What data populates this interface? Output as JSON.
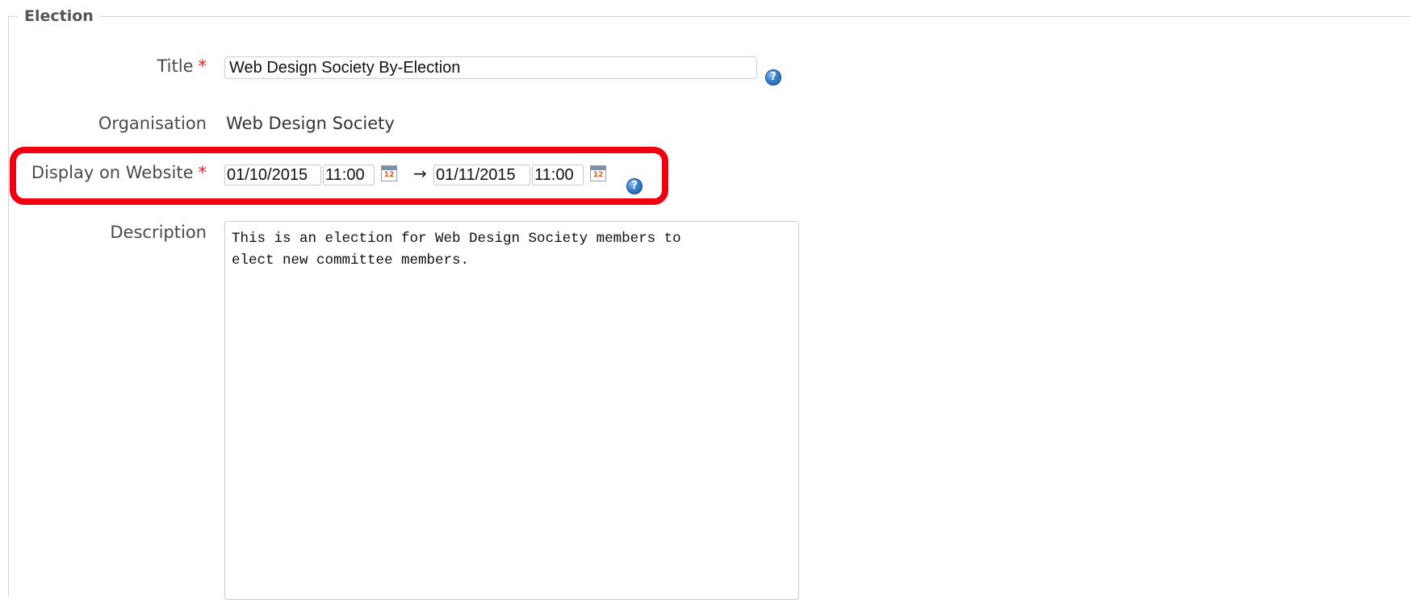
{
  "fieldset": {
    "legend": "Election"
  },
  "fields": {
    "title": {
      "label": "Title",
      "required_marker": "*",
      "value": "Web Design Society By-Election",
      "help_icon": "help-icon"
    },
    "organisation": {
      "label": "Organisation",
      "value": "Web Design Society"
    },
    "display_on_website": {
      "label": "Display on Website",
      "required_marker": "*",
      "start_date": "01/10/2015",
      "start_time": "11:00",
      "calendar_icon_text": "12",
      "arrow": "→",
      "end_date": "01/11/2015",
      "end_time": "11:00",
      "help_icon": "help-icon"
    },
    "description": {
      "label": "Description",
      "value": "This is an election for Web Design Society members to\nelect new committee members."
    }
  },
  "colors": {
    "required_marker": "#d9232a",
    "highlight_border": "#f0000f",
    "help_icon": "#3b7fd0"
  }
}
